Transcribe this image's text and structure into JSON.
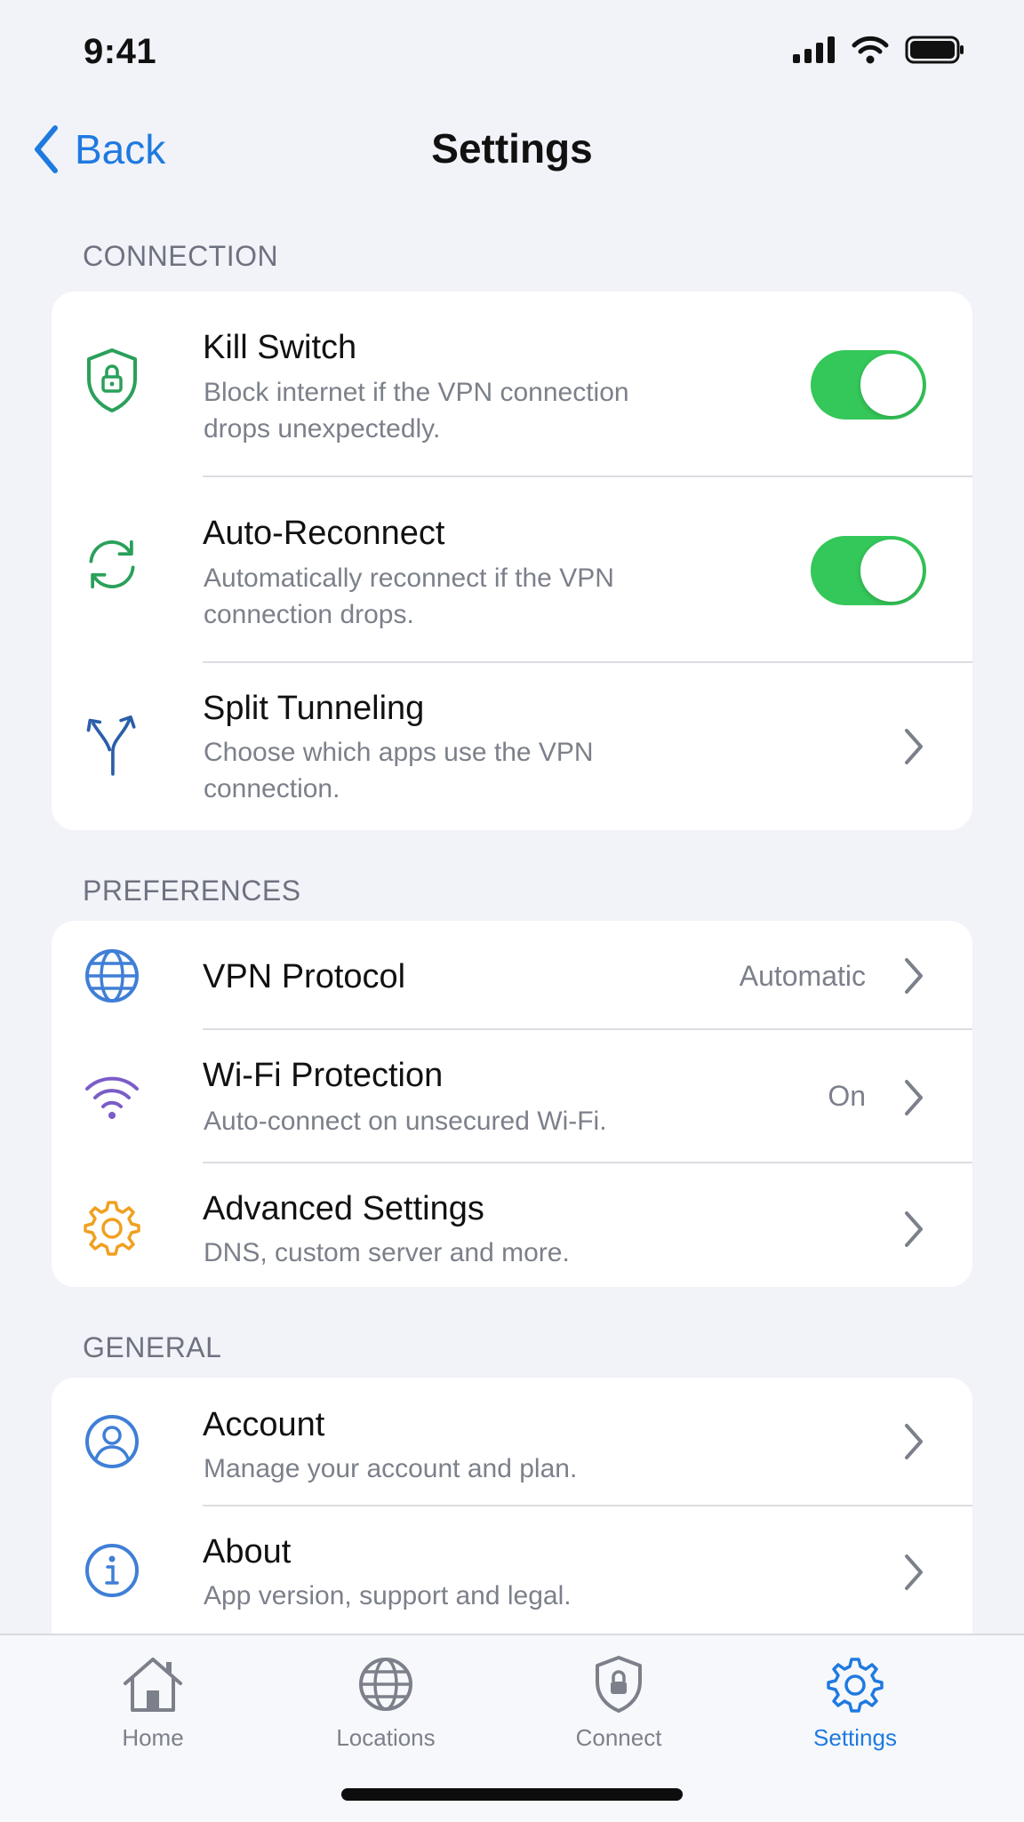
{
  "status_bar": {
    "time": "9:41"
  },
  "nav": {
    "back_label": "Back",
    "title": "Settings"
  },
  "sections": {
    "connection": {
      "header": "CONNECTION",
      "kill_switch": {
        "title": "Kill Switch",
        "subtitle": "Block internet if the VPN connection drops unexpectedly.",
        "enabled": true
      },
      "auto_reconnect": {
        "title": "Auto-Reconnect",
        "subtitle": "Automatically reconnect if the VPN connection drops.",
        "enabled": true
      },
      "split_tunneling": {
        "title": "Split Tunneling",
        "subtitle": "Choose which apps use the VPN connection."
      }
    },
    "preferences": {
      "header": "PREFERENCES",
      "vpn_protocol": {
        "title": "VPN Protocol",
        "value": "Automatic"
      },
      "wifi_protection": {
        "title": "Wi-Fi Protection",
        "subtitle": "Auto-connect on unsecured Wi-Fi.",
        "value": "On"
      },
      "advanced": {
        "title": "Advanced Settings",
        "subtitle": "DNS, custom server and more."
      }
    },
    "general": {
      "header": "GENERAL",
      "account": {
        "title": "Account",
        "subtitle": "Manage your account and plan."
      },
      "about": {
        "title": "About",
        "subtitle": "App version, support and legal."
      }
    }
  },
  "tabbar": {
    "tabs": [
      {
        "label": "Home",
        "icon": "house-icon",
        "active": false
      },
      {
        "label": "Locations",
        "icon": "globe-icon",
        "active": false
      },
      {
        "label": "Connect",
        "icon": "shield-lock-icon",
        "active": false
      },
      {
        "label": "Settings",
        "icon": "gear-icon",
        "active": true
      }
    ]
  },
  "colors": {
    "accent": "#1f7ae0",
    "toggle_on": "#34c759",
    "green_icon": "#2aa05a",
    "purple_icon": "#7a5cc8",
    "orange_icon": "#f0a020",
    "blue_icon": "#3f7fd6"
  }
}
